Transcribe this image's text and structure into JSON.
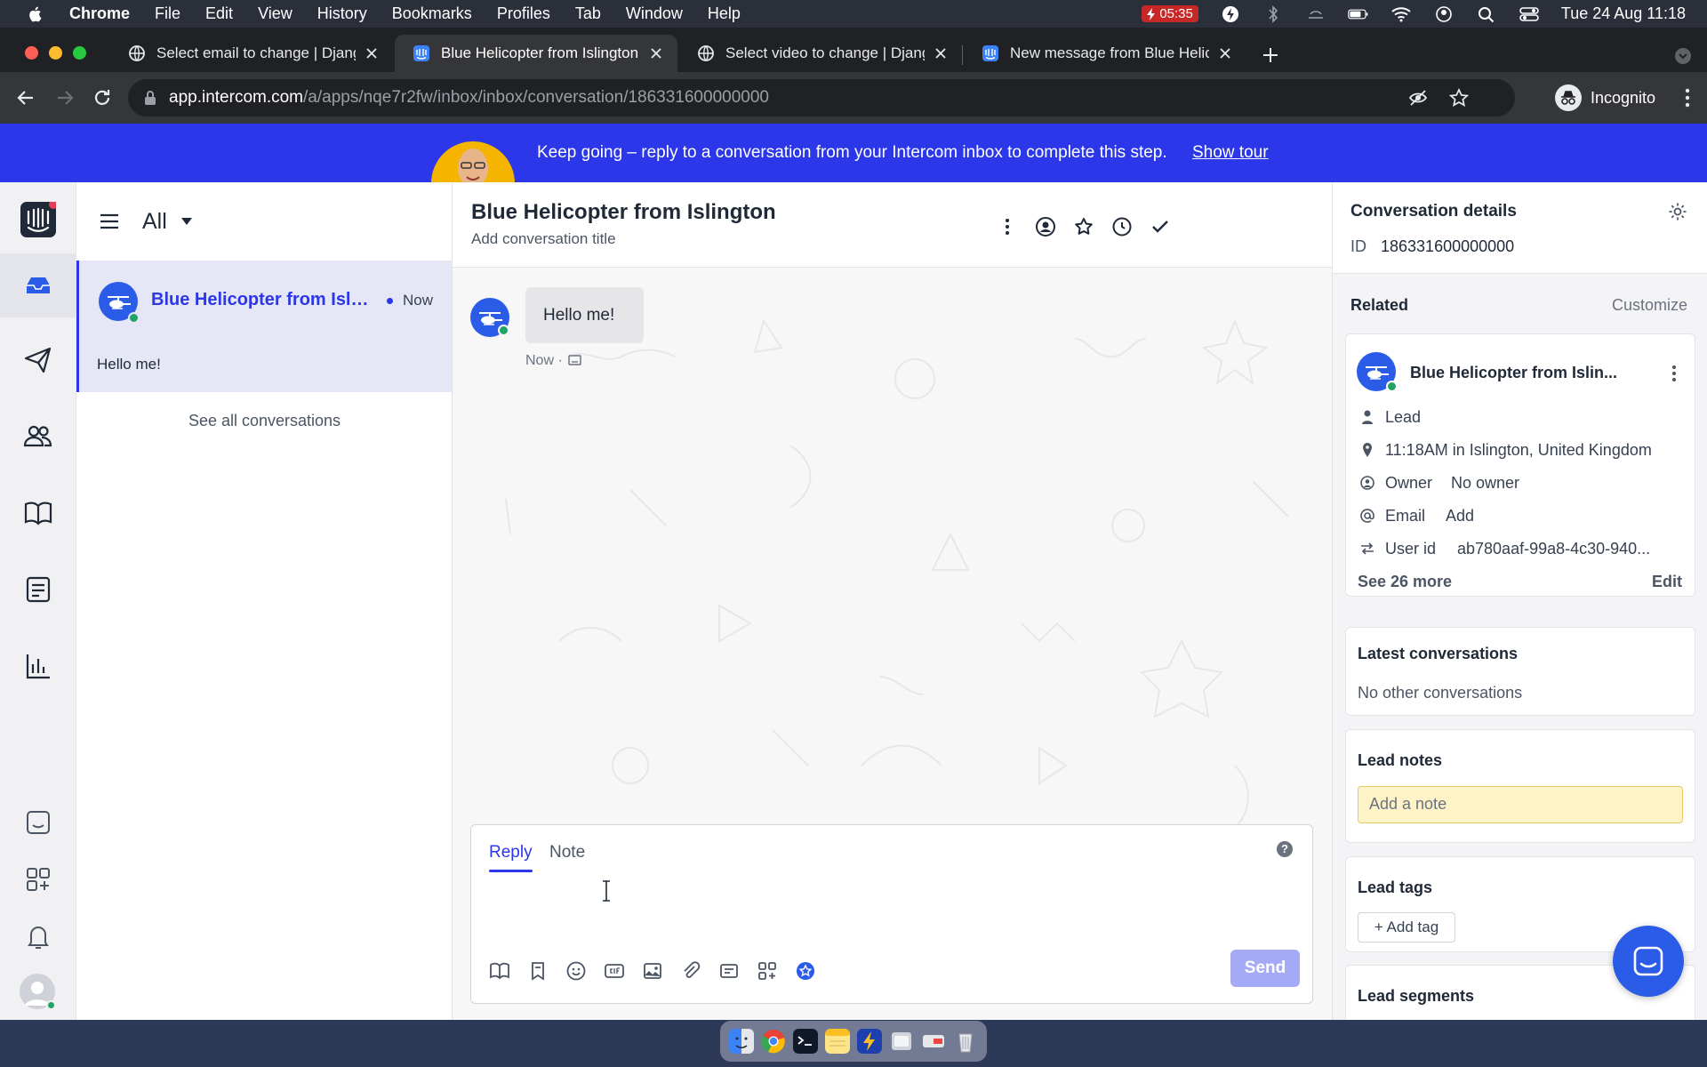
{
  "menubar": {
    "app": "Chrome",
    "items": [
      "File",
      "Edit",
      "View",
      "History",
      "Bookmarks",
      "Profiles",
      "Tab",
      "Window",
      "Help"
    ],
    "timer": "05:35",
    "datetime": "Tue 24 Aug  11:18"
  },
  "tabs": [
    {
      "title": "Select email to change | Djang"
    },
    {
      "title": "Blue Helicopter from Islington |"
    },
    {
      "title": "Select video to change | Djang"
    },
    {
      "title": "New message from Blue Helic"
    }
  ],
  "addressbar": {
    "host": "app.intercom.com",
    "path": "/a/apps/nqe7r2fw/inbox/inbox/conversation/186331600000000",
    "profile": "Incognito"
  },
  "banner": {
    "message": "Keep going – reply to a conversation from your Intercom inbox to complete this step.",
    "link": "Show tour"
  },
  "inbox": {
    "filter": "All",
    "conversation": {
      "name": "Blue Helicopter from Islin...",
      "time": "Now",
      "snippet": "Hello me!"
    },
    "see_all": "See all conversations"
  },
  "conversation": {
    "title": "Blue Helicopter from Islington",
    "subtitle": "Add conversation title",
    "message": "Hello me!",
    "meta": "Now ·"
  },
  "composer": {
    "tab_reply": "Reply",
    "tab_note": "Note",
    "help": "?",
    "send": "Send"
  },
  "details": {
    "title": "Conversation details",
    "id_label": "ID",
    "id_value": "186331600000000",
    "related": "Related",
    "customize": "Customize",
    "contact": {
      "name": "Blue Helicopter from Islin...",
      "type": "Lead",
      "location": "11:18AM in Islington, United Kingdom",
      "owner_label": "Owner",
      "owner_value": "No owner",
      "email_label": "Email",
      "email_value": "Add",
      "userid_label": "User id",
      "userid_value": "ab780aaf-99a8-4c30-940...",
      "see_more": "See 26 more",
      "edit": "Edit"
    },
    "latest_title": "Latest conversations",
    "latest_empty": "No other conversations",
    "notes_title": "Lead notes",
    "notes_placeholder": "Add a note",
    "tags_title": "Lead tags",
    "tags_add": "+ Add tag",
    "segments_title": "Lead segments"
  },
  "colors": {
    "accent": "#2b37e8",
    "online": "#21a366",
    "note": "#fef3c7"
  }
}
